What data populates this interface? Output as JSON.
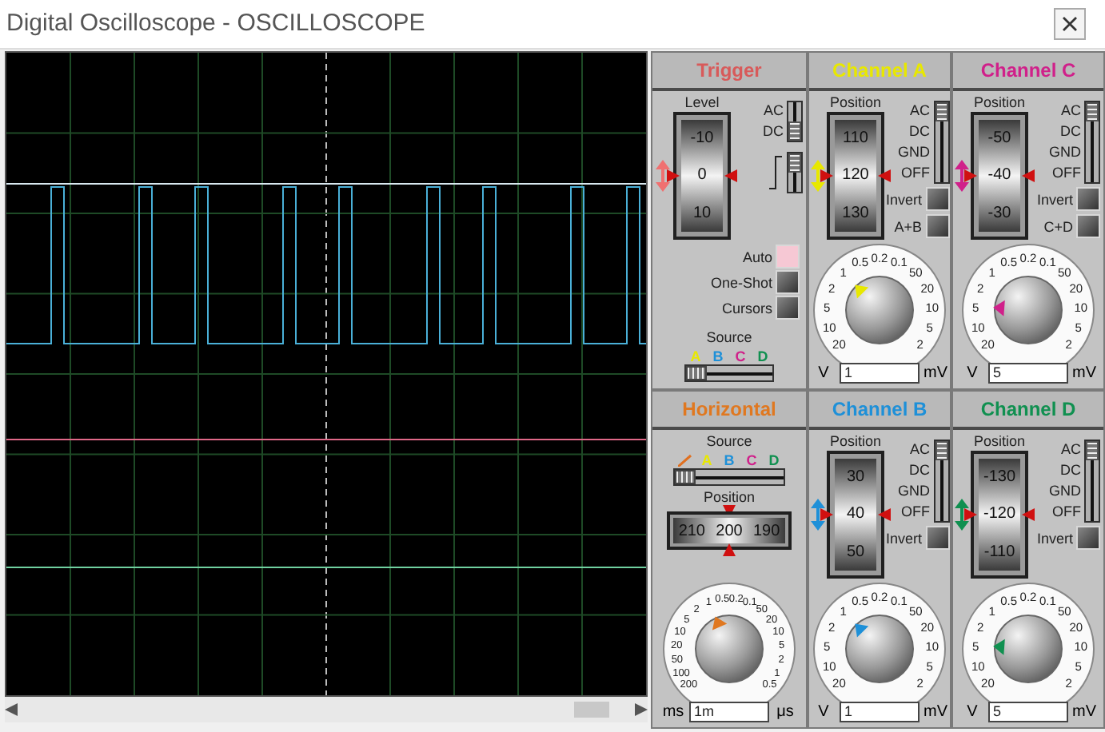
{
  "window": {
    "title": "Digital Oscilloscope - OSCILLOSCOPE"
  },
  "trigger": {
    "title": "Trigger",
    "level_label": "Level",
    "scale": [
      "-10",
      "0",
      "10"
    ],
    "coupling": [
      {
        "label": "AC",
        "selected": false
      },
      {
        "label": "DC",
        "selected": true
      }
    ],
    "edge": [
      {
        "selected": true
      },
      {
        "selected": false
      }
    ],
    "buttons": [
      {
        "label": "Auto",
        "on": true
      },
      {
        "label": "One-Shot",
        "on": false
      },
      {
        "label": "Cursors",
        "on": false
      }
    ],
    "source_label": "Source",
    "sources": [
      {
        "kind": "letter",
        "label": "A",
        "color": "#e8e800",
        "selected": true
      },
      {
        "kind": "letter",
        "label": "B",
        "color": "#1e90d8",
        "selected": false
      },
      {
        "kind": "letter",
        "label": "C",
        "color": "#d0208a",
        "selected": false
      },
      {
        "kind": "letter",
        "label": "D",
        "color": "#109050",
        "selected": false
      }
    ]
  },
  "horizontal": {
    "title": "Horizontal",
    "source_label": "Source",
    "sources": [
      {
        "kind": "ramp",
        "color": "#e07020",
        "selected": true
      },
      {
        "kind": "letter",
        "label": "A",
        "color": "#e8e800",
        "selected": false
      },
      {
        "kind": "letter",
        "label": "B",
        "color": "#1e90d8",
        "selected": false
      },
      {
        "kind": "letter",
        "label": "C",
        "color": "#d0208a",
        "selected": false
      },
      {
        "kind": "letter",
        "label": "D",
        "color": "#109050",
        "selected": false
      }
    ],
    "position_label": "Position",
    "scale": [
      "210",
      "200",
      "190"
    ],
    "dial": {
      "level": 0.41,
      "left_labels": [
        "0.5",
        "1",
        "2",
        "5",
        "10",
        "20",
        "50",
        "100",
        "200"
      ],
      "right_labels": [
        "0.2",
        "0.1",
        "50",
        "20",
        "10",
        "5",
        "2",
        "1",
        "0.5"
      ],
      "unit_left": "ms",
      "unit_right": "μs",
      "value": "1m"
    }
  },
  "channels": [
    {
      "title": "Channel A",
      "color": "#e8e800",
      "position_label": "Position",
      "scale": [
        "110",
        "120",
        "130"
      ],
      "modes": [
        {
          "label": "AC",
          "selected": true
        },
        {
          "label": "DC",
          "selected": false
        },
        {
          "label": "GND",
          "selected": false
        },
        {
          "label": "OFF",
          "selected": false
        }
      ],
      "buttons": [
        {
          "label": "Invert",
          "on": false
        },
        {
          "label": "A+B",
          "on": false
        }
      ],
      "dial": {
        "level": 0.33,
        "left_labels": [
          "0.5",
          "1",
          "2",
          "5",
          "10",
          "20"
        ],
        "right_labels": [
          "0.2",
          "0.1",
          "50",
          "20",
          "10",
          "5",
          "2"
        ],
        "unit_left": "V",
        "unit_right": "mV",
        "value": "1"
      }
    },
    {
      "title": "Channel C",
      "color": "#d0208a",
      "position_label": "Position",
      "scale": [
        "-50",
        "-40",
        "-30"
      ],
      "modes": [
        {
          "label": "AC",
          "selected": true
        },
        {
          "label": "DC",
          "selected": false
        },
        {
          "label": "GND",
          "selected": false
        },
        {
          "label": "OFF",
          "selected": false
        }
      ],
      "buttons": [
        {
          "label": "Invert",
          "on": false
        },
        {
          "label": "C+D",
          "on": false
        }
      ],
      "dial": {
        "level": 0.17,
        "left_labels": [
          "0.5",
          "1",
          "2",
          "5",
          "10",
          "20"
        ],
        "right_labels": [
          "0.2",
          "0.1",
          "50",
          "20",
          "10",
          "5",
          "2"
        ],
        "unit_left": "V",
        "unit_right": "mV",
        "value": "5"
      }
    },
    {
      "title": "Channel B",
      "color": "#1e90d8",
      "position_label": "Position",
      "scale": [
        "30",
        "40",
        "50"
      ],
      "modes": [
        {
          "label": "AC",
          "selected": true
        },
        {
          "label": "DC",
          "selected": false
        },
        {
          "label": "GND",
          "selected": false
        },
        {
          "label": "OFF",
          "selected": false
        }
      ],
      "buttons": [
        {
          "label": "Invert",
          "on": false
        }
      ],
      "dial": {
        "level": 0.33,
        "left_labels": [
          "0.5",
          "1",
          "2",
          "5",
          "10",
          "20"
        ],
        "right_labels": [
          "0.2",
          "0.1",
          "50",
          "20",
          "10",
          "5",
          "2"
        ],
        "unit_left": "V",
        "unit_right": "mV",
        "value": "1"
      }
    },
    {
      "title": "Channel D",
      "color": "#109050",
      "position_label": "Position",
      "scale": [
        "-130",
        "-120",
        "-110"
      ],
      "modes": [
        {
          "label": "AC",
          "selected": true
        },
        {
          "label": "DC",
          "selected": false
        },
        {
          "label": "GND",
          "selected": false
        },
        {
          "label": "OFF",
          "selected": false
        }
      ],
      "buttons": [
        {
          "label": "Invert",
          "on": false
        }
      ],
      "dial": {
        "level": 0.17,
        "left_labels": [
          "0.5",
          "1",
          "2",
          "5",
          "10",
          "20"
        ],
        "right_labels": [
          "0.2",
          "0.1",
          "50",
          "20",
          "10",
          "5",
          "2"
        ],
        "unit_left": "V",
        "unit_right": "mV",
        "value": "5"
      }
    }
  ]
}
